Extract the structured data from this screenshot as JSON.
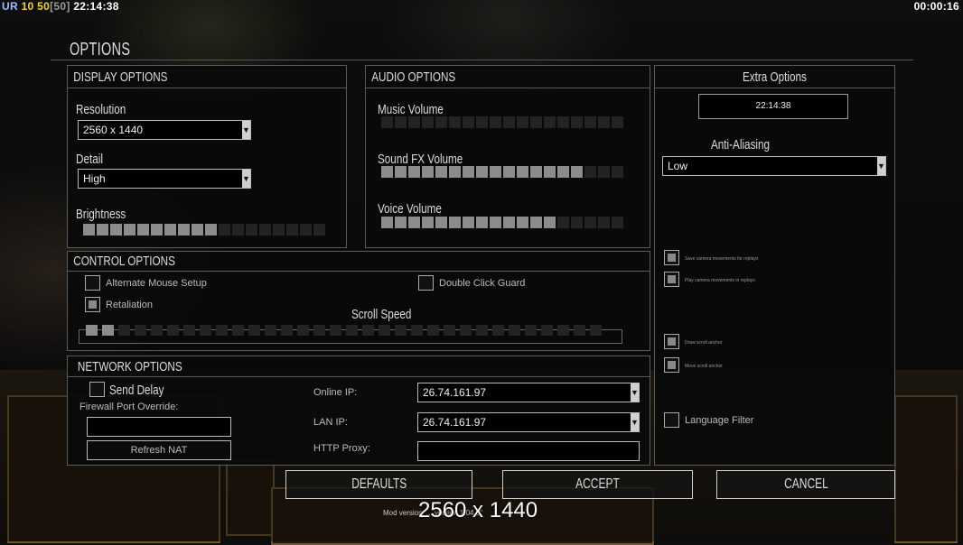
{
  "hud": {
    "prefix": "UR",
    "a": "10",
    "b": "50",
    "c": "[50]",
    "clock": "22:14:38",
    "timer": "00:00:16"
  },
  "title": "OPTIONS",
  "display": {
    "title": "DISPLAY OPTIONS",
    "resolution_label": "Resolution",
    "resolution_value": "2560 x 1440",
    "detail_label": "Detail",
    "detail_value": "High",
    "brightness_label": "Brightness",
    "brightness_level": 10,
    "brightness_segments": 18
  },
  "audio": {
    "title": "AUDIO OPTIONS",
    "music_label": "Music Volume",
    "music_level": 0,
    "sfx_label": "Sound FX Volume",
    "sfx_level": 15,
    "voice_label": "Voice Volume",
    "voice_level": 13,
    "segments": 18
  },
  "extra": {
    "title": "Extra Options",
    "clock_value": "22:14:38",
    "aa_label": "Anti-Aliasing",
    "aa_value": "Low",
    "save_camera": "Save camera movements for replays",
    "play_camera": "Play camera movements in replays",
    "draw_scroll": "Draw scroll anchor",
    "move_scroll": "Move scroll anchor",
    "language_filter": "Language Filter"
  },
  "control": {
    "title": "CONTROL OPTIONS",
    "alt_mouse": "Alternate Mouse Setup",
    "double_click": "Double Click Guard",
    "retaliation": "Retaliation",
    "scroll_label": "Scroll Speed",
    "scroll_level": 2,
    "scroll_segments": 32
  },
  "network": {
    "title": "NETWORK OPTIONS",
    "send_delay": "Send Delay",
    "firewall_label": "Firewall Port Override:",
    "firewall_value": "",
    "refresh_nat": "Refresh NAT",
    "online_ip_label": "Online IP:",
    "online_ip": "26.74.161.97",
    "lan_ip_label": "LAN IP:",
    "lan_ip": "26.74.161.97",
    "http_proxy_label": "HTTP Proxy:",
    "http_proxy": ""
  },
  "buttons": {
    "defaults": "DEFAULTS",
    "accept": "ACCEPT",
    "cancel": "CANCEL"
  },
  "footer": {
    "mod_version": "Mod version: ... version 1.04.0\"",
    "resolution_overlay": "2560 x 1440"
  }
}
